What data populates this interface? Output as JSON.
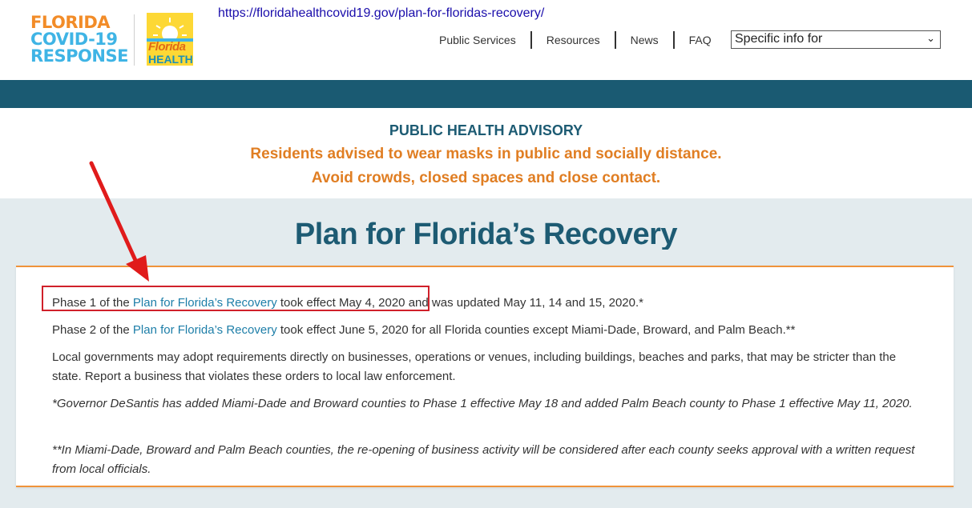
{
  "browser": {
    "url": "https://floridahealthcovid19.gov/plan-for-floridas-recovery/"
  },
  "header": {
    "logo": {
      "line1": "FLORIDA",
      "line2": "COVID-19",
      "line3": "RESPONSE"
    },
    "fh_logo": {
      "line1": "Florida",
      "line2": "HEALTH"
    },
    "nav": [
      "Public Services",
      "Resources",
      "News",
      "FAQ"
    ],
    "select": {
      "value": "Specific info for"
    }
  },
  "advisory": {
    "title": "PUBLIC HEALTH ADVISORY",
    "line1": "Residents advised to wear masks in public and socially distance.",
    "line2": "Avoid crowds, closed spaces and close contact."
  },
  "main": {
    "title": "Plan for Florida’s Recovery",
    "p1": {
      "pre": "Phase 1 of the ",
      "link": "Plan for Florida’s Recovery",
      "mid": " took effect May 4, 2020",
      "post": " and was updated May 11, 14 and 15, 2020.*"
    },
    "p2": {
      "pre": "Phase 2 of the ",
      "link": "Plan for Florida’s Recovery",
      "post": " took effect June 5, 2020 for all Florida counties except Miami-Dade, Broward, and Palm Beach.**"
    },
    "p3": "Local governments may adopt requirements directly on businesses, operations or venues, including buildings, beaches and parks, that may be stricter than the state. Report a business that violates these orders to local law enforcement.",
    "p4": "*Governor DeSantis has added Miami-Dade and Broward counties to Phase 1 effective May 18 and added Palm Beach county to Phase 1 effective May 11, 2020.",
    "p5": "**In Miami-Dade, Broward and Palm Beach counties, the re-opening of business activity  will be considered after each county seeks approval with a written request from local officials."
  },
  "colors": {
    "teal": "#1a5a72",
    "orange": "#e07e23",
    "link": "#1d7ea8",
    "annotation": "#d0202a"
  }
}
